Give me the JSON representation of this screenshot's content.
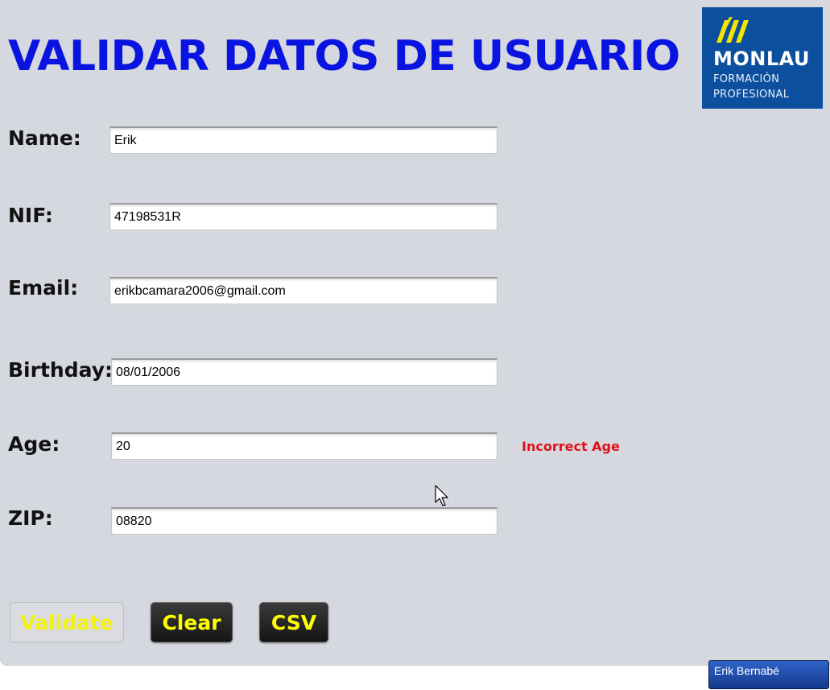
{
  "page": {
    "title": "VALIDAR DATOS DE USUARIO"
  },
  "logo": {
    "name": "MONLAU",
    "line1": "FORMACIÓN",
    "line2": "PROFESIONAL"
  },
  "form": {
    "fields": [
      {
        "label": "Name:",
        "value": "Erik"
      },
      {
        "label": "NIF:",
        "value": "47198531R"
      },
      {
        "label": "Email:",
        "value": "erikbcamara2006@gmail.com"
      },
      {
        "label": "Birthday:",
        "value": "08/01/2006"
      },
      {
        "label": "Age:",
        "value": "20"
      },
      {
        "label": "ZIP:",
        "value": "08820"
      }
    ],
    "age_error": "Incorrect Age"
  },
  "buttons": {
    "validate": "Validate",
    "clear": "Clear",
    "csv": "CSV"
  },
  "taskbar": {
    "user_button": "Erik Bernabé"
  },
  "colors": {
    "title": "#0a14e0",
    "button_text": "#ffff00",
    "error": "#e0101a",
    "logo_bg": "#0c4f9f",
    "logo_accent": "#f4e600",
    "panel_bg": "#d6d8e0"
  }
}
